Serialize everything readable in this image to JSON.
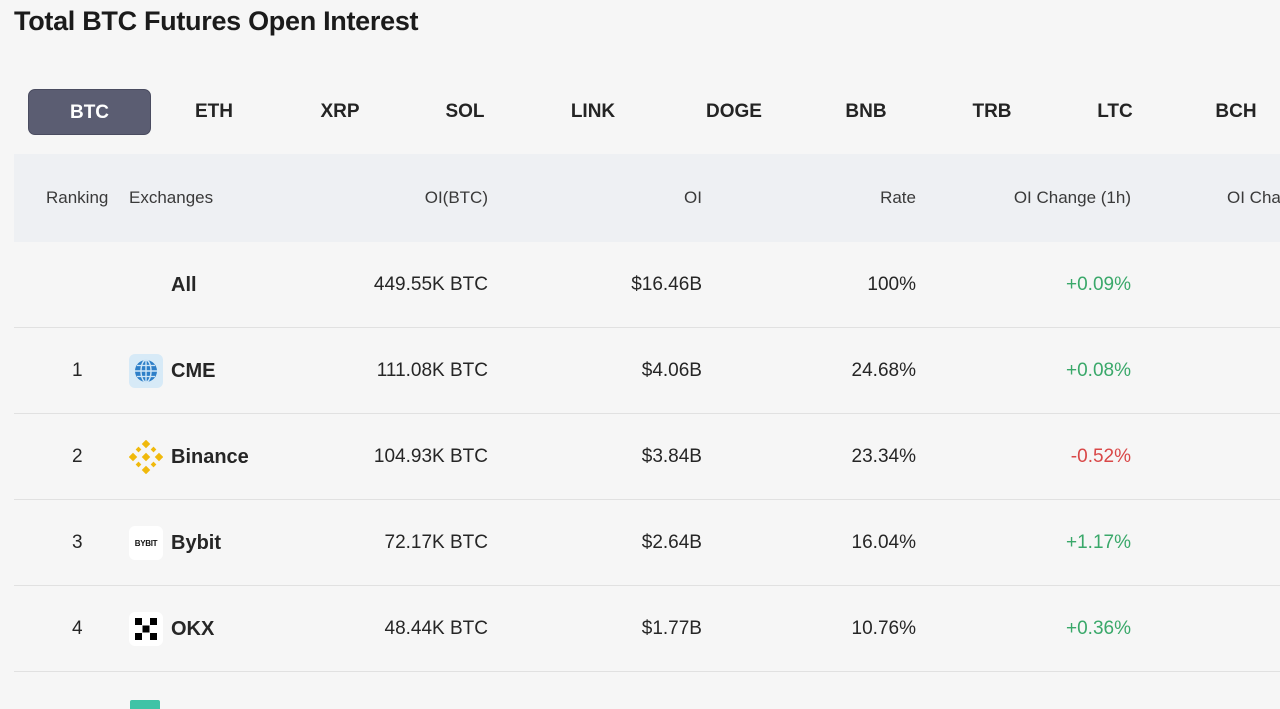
{
  "page": {
    "title": "Total BTC Futures Open Interest"
  },
  "tabs": [
    {
      "label": "BTC",
      "active": true
    },
    {
      "label": "ETH"
    },
    {
      "label": "XRP"
    },
    {
      "label": "SOL"
    },
    {
      "label": "LINK"
    },
    {
      "label": "DOGE"
    },
    {
      "label": "BNB"
    },
    {
      "label": "TRB"
    },
    {
      "label": "LTC"
    },
    {
      "label": "BCH"
    }
  ],
  "table": {
    "headers": {
      "ranking": "Ranking",
      "exchanges": "Exchanges",
      "oi_btc": "OI(BTC)",
      "oi": "OI",
      "rate": "Rate",
      "oi_change_1h": "OI Change (1h)",
      "oi_change_cut": "OI Cha"
    },
    "rows": [
      {
        "rank": "",
        "exchange": "All",
        "oi_btc": "449.55K BTC",
        "oi": "$16.46B",
        "rate": "100%",
        "change_1h": "+0.09%",
        "trend": "up"
      },
      {
        "rank": "1",
        "exchange": "CME",
        "logo": "cme-globe-icon",
        "oi_btc": "111.08K BTC",
        "oi": "$4.06B",
        "rate": "24.68%",
        "change_1h": "+0.08%",
        "trend": "up"
      },
      {
        "rank": "2",
        "exchange": "Binance",
        "logo": "binance-icon",
        "oi_btc": "104.93K BTC",
        "oi": "$3.84B",
        "rate": "23.34%",
        "change_1h": "-0.52%",
        "trend": "down"
      },
      {
        "rank": "3",
        "exchange": "Bybit",
        "logo": "bybit-icon",
        "logo_text": "BYBIT",
        "oi_btc": "72.17K BTC",
        "oi": "$2.64B",
        "rate": "16.04%",
        "change_1h": "+1.17%",
        "trend": "up"
      },
      {
        "rank": "4",
        "exchange": "OKX",
        "logo": "okx-icon",
        "oi_btc": "48.44K BTC",
        "oi": "$1.77B",
        "rate": "10.76%",
        "change_1h": "+0.36%",
        "trend": "up"
      }
    ]
  },
  "colors": {
    "active_tab": "#5b5d72",
    "positive": "#3aa86a",
    "negative": "#d94848",
    "header_bg": "#eef0f3"
  }
}
